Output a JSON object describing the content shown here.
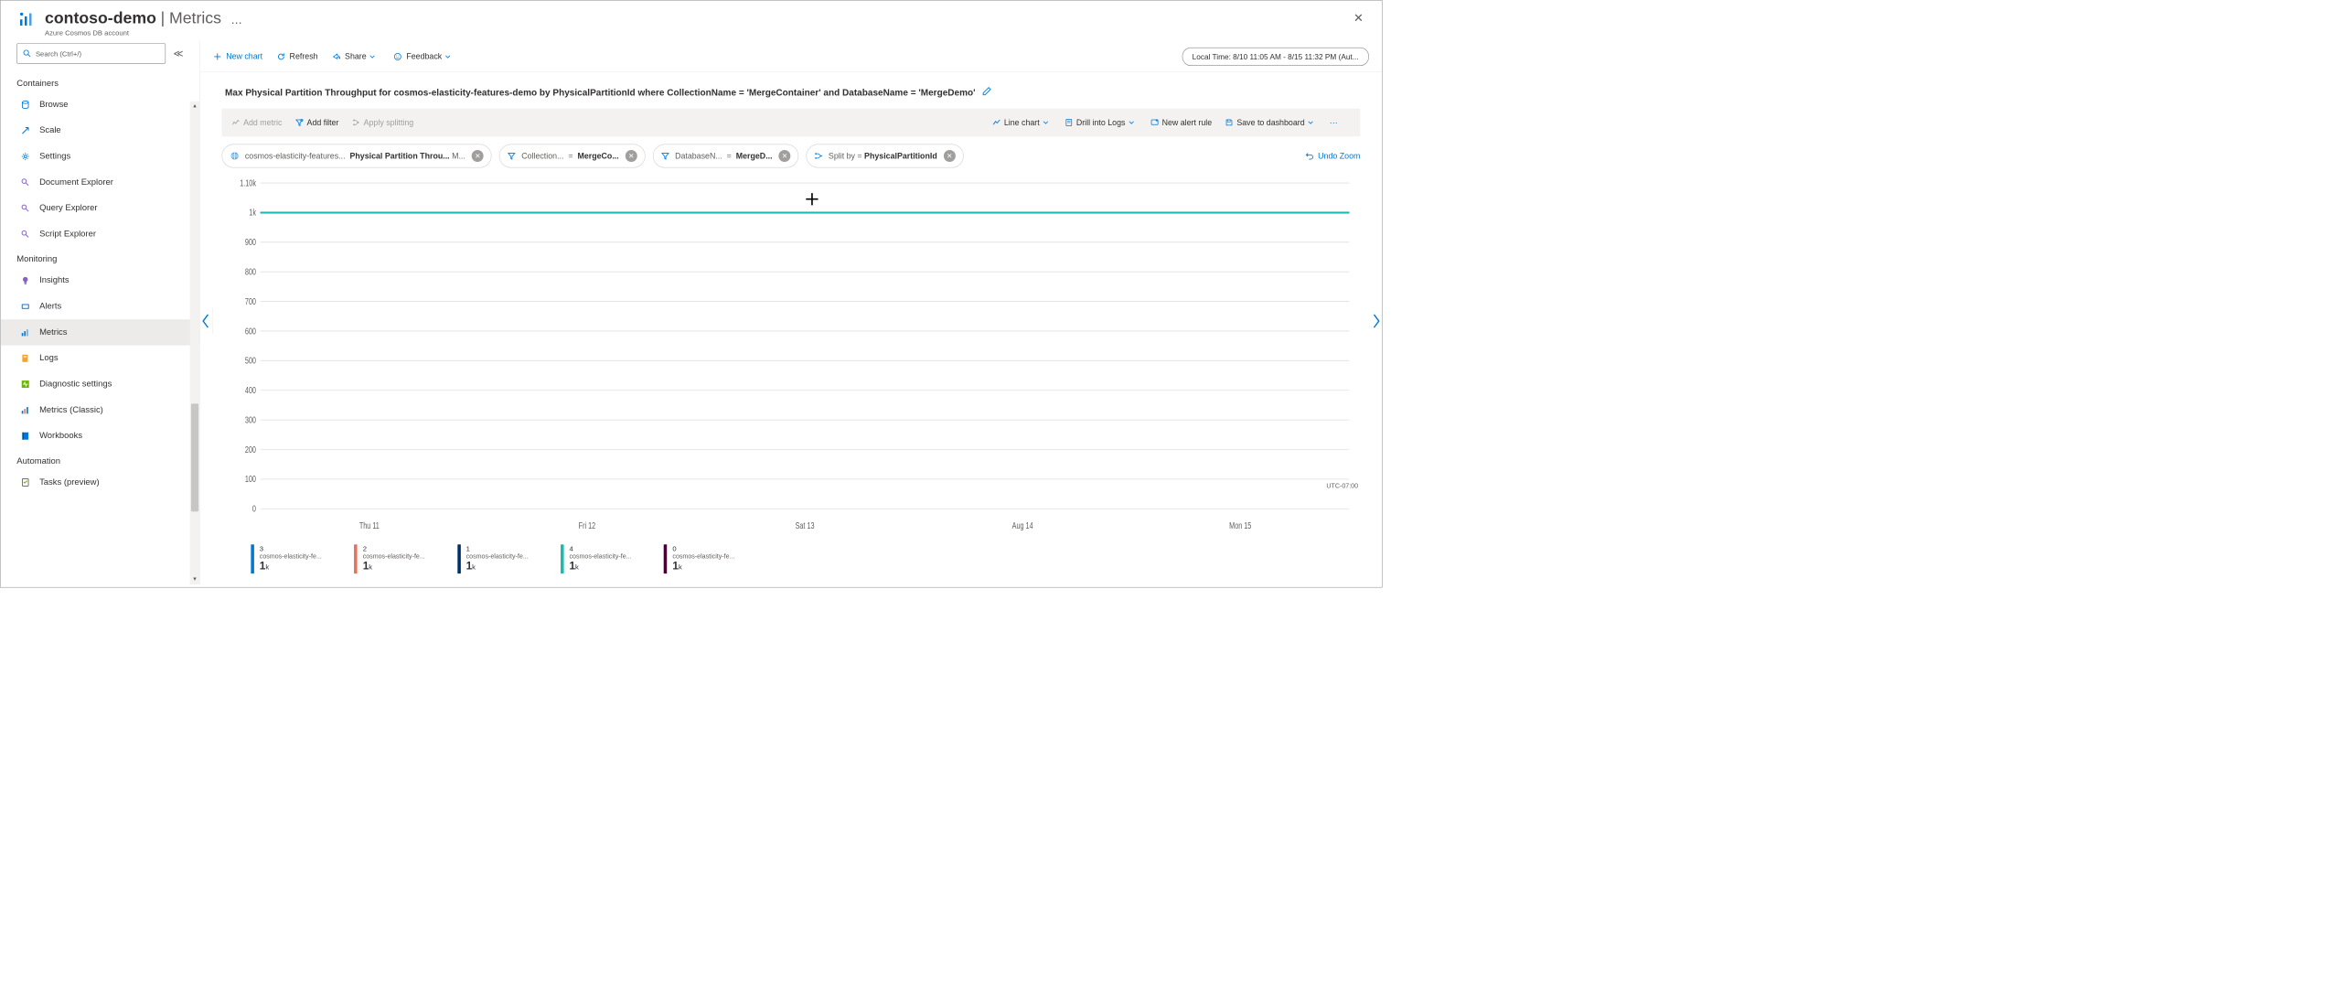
{
  "header": {
    "resource_name": "contoso-demo",
    "blade_name": "Metrics",
    "resource_type": "Azure Cosmos DB account"
  },
  "search": {
    "placeholder": "Search (Ctrl+/)"
  },
  "nav": {
    "groups": [
      {
        "label": "Containers",
        "items": [
          {
            "icon": "browse",
            "label": "Browse"
          },
          {
            "icon": "scale",
            "label": "Scale"
          },
          {
            "icon": "settings",
            "label": "Settings"
          },
          {
            "icon": "doc",
            "label": "Document Explorer"
          },
          {
            "icon": "query",
            "label": "Query Explorer"
          },
          {
            "icon": "script",
            "label": "Script Explorer"
          }
        ]
      },
      {
        "label": "Monitoring",
        "items": [
          {
            "icon": "insights",
            "label": "Insights"
          },
          {
            "icon": "alerts",
            "label": "Alerts"
          },
          {
            "icon": "metrics",
            "label": "Metrics",
            "active": true
          },
          {
            "icon": "logs",
            "label": "Logs"
          },
          {
            "icon": "diag",
            "label": "Diagnostic settings"
          },
          {
            "icon": "metricsc",
            "label": "Metrics (Classic)"
          },
          {
            "icon": "workbooks",
            "label": "Workbooks"
          }
        ]
      },
      {
        "label": "Automation",
        "items": [
          {
            "icon": "tasks",
            "label": "Tasks (preview)"
          }
        ]
      }
    ]
  },
  "toolbar": {
    "new_chart": "New chart",
    "refresh": "Refresh",
    "share": "Share",
    "feedback": "Feedback",
    "time_range": "Local Time: 8/10 11:05 AM - 8/15 11:32 PM (Aut..."
  },
  "chart": {
    "title": "Max Physical Partition Throughput for cosmos-elasticity-features-demo by PhysicalPartitionId where CollectionName = 'MergeContainer' and DatabaseName = 'MergeDemo'",
    "querybar": {
      "add_metric": "Add metric",
      "add_filter": "Add filter",
      "apply_splitting": "Apply splitting",
      "line_chart": "Line chart",
      "drill_logs": "Drill into Logs",
      "new_alert": "New alert rule",
      "save_dash": "Save to dashboard"
    },
    "pills": {
      "metric": {
        "scope": "cosmos-elasticity-features...",
        "name": "Physical Partition Throu...",
        "agg": "M..."
      },
      "filter1": {
        "key": "Collection...",
        "op": "=",
        "val": "MergeCo..."
      },
      "filter2": {
        "key": "DatabaseN...",
        "op": "=",
        "val": "MergeD..."
      },
      "split": {
        "label": "Split by",
        "op": "=",
        "val": "PhysicalPartitionId"
      }
    },
    "undo_zoom": "Undo Zoom",
    "timezone": "UTC-07:00",
    "legend": [
      {
        "color": "#0078d4",
        "id": "3",
        "src": "cosmos-elasticity-fe...",
        "val": "1",
        "unit": "k"
      },
      {
        "color": "#e3735e",
        "id": "2",
        "src": "cosmos-elasticity-fe...",
        "val": "1",
        "unit": "k"
      },
      {
        "color": "#002f6c",
        "id": "1",
        "src": "cosmos-elasticity-fe...",
        "val": "1",
        "unit": "k"
      },
      {
        "color": "#1cbab0",
        "id": "4",
        "src": "cosmos-elasticity-fe...",
        "val": "1",
        "unit": "k"
      },
      {
        "color": "#4b0033",
        "id": "0",
        "src": "cosmos-elasticity-fe...",
        "val": "1",
        "unit": "k"
      }
    ]
  },
  "chart_data": {
    "type": "line",
    "title": "Max Physical Partition Throughput",
    "xlabel": "",
    "ylabel": "",
    "ylim": [
      0,
      1100
    ],
    "x_categories": [
      "Thu 11",
      "Fri 12",
      "Sat 13",
      "Aug 14",
      "Mon 15"
    ],
    "y_ticks": [
      0,
      100,
      200,
      300,
      400,
      500,
      600,
      700,
      800,
      900,
      1000,
      1100
    ],
    "y_tick_labels": [
      "0",
      "100",
      "200",
      "300",
      "400",
      "500",
      "600",
      "700",
      "800",
      "900",
      "1k",
      "1.10k"
    ],
    "series": [
      {
        "name": "0",
        "color": "#4b0033",
        "values": [
          1000,
          1000,
          1000,
          1000,
          1000
        ]
      },
      {
        "name": "1",
        "color": "#002f6c",
        "values": [
          1000,
          1000,
          1000,
          1000,
          1000
        ]
      },
      {
        "name": "2",
        "color": "#e3735e",
        "values": [
          1000,
          1000,
          1000,
          1000,
          1000
        ]
      },
      {
        "name": "3",
        "color": "#0078d4",
        "values": [
          1000,
          1000,
          1000,
          1000,
          1000
        ]
      },
      {
        "name": "4",
        "color": "#1cbab0",
        "values": [
          1000,
          1000,
          1000,
          1000,
          1000
        ]
      }
    ]
  }
}
